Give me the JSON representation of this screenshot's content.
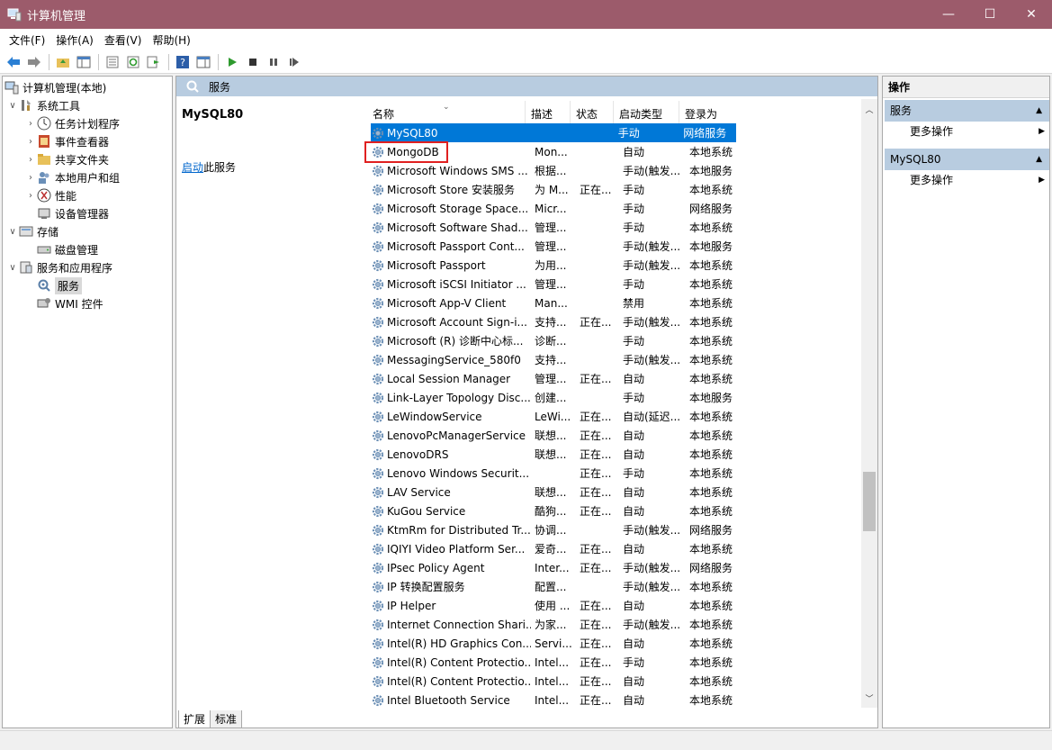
{
  "window": {
    "title": "计算机管理",
    "minimize": "—",
    "maximize": "☐",
    "close": "✕"
  },
  "menu": [
    "文件(F)",
    "操作(A)",
    "查看(V)",
    "帮助(H)"
  ],
  "tree": {
    "root": "计算机管理(本地)",
    "items": [
      {
        "label": "系统工具"
      },
      {
        "label": "任务计划程序"
      },
      {
        "label": "事件查看器"
      },
      {
        "label": "共享文件夹"
      },
      {
        "label": "本地用户和组"
      },
      {
        "label": "性能"
      },
      {
        "label": "设备管理器"
      },
      {
        "label": "存储"
      },
      {
        "label": "磁盘管理"
      },
      {
        "label": "服务和应用程序"
      },
      {
        "label": "服务"
      },
      {
        "label": "WMI 控件"
      }
    ]
  },
  "main": {
    "header": "服务",
    "selected_service": "MySQL80",
    "start_link": "启动",
    "start_text": "此服务",
    "columns": [
      "名称",
      "描述",
      "状态",
      "启动类型",
      "登录为"
    ],
    "rows": [
      {
        "name": "MySQL80",
        "desc": "",
        "state": "",
        "start": "手动",
        "logon": "网络服务"
      },
      {
        "name": "MongoDB",
        "desc": "Mon...",
        "state": "",
        "start": "自动",
        "logon": "本地系统"
      },
      {
        "name": "Microsoft Windows SMS ...",
        "desc": "根据...",
        "state": "",
        "start": "手动(触发...",
        "logon": "本地服务"
      },
      {
        "name": "Microsoft Store 安装服务",
        "desc": "为 M...",
        "state": "正在...",
        "start": "手动",
        "logon": "本地系统"
      },
      {
        "name": "Microsoft Storage Space...",
        "desc": "Micr...",
        "state": "",
        "start": "手动",
        "logon": "网络服务"
      },
      {
        "name": "Microsoft Software Shad...",
        "desc": "管理...",
        "state": "",
        "start": "手动",
        "logon": "本地系统"
      },
      {
        "name": "Microsoft Passport Cont...",
        "desc": "管理...",
        "state": "",
        "start": "手动(触发...",
        "logon": "本地服务"
      },
      {
        "name": "Microsoft Passport",
        "desc": "为用...",
        "state": "",
        "start": "手动(触发...",
        "logon": "本地系统"
      },
      {
        "name": "Microsoft iSCSI Initiator ...",
        "desc": "管理...",
        "state": "",
        "start": "手动",
        "logon": "本地系统"
      },
      {
        "name": "Microsoft App-V Client",
        "desc": "Man...",
        "state": "",
        "start": "禁用",
        "logon": "本地系统"
      },
      {
        "name": "Microsoft Account Sign-i...",
        "desc": "支持...",
        "state": "正在...",
        "start": "手动(触发...",
        "logon": "本地系统"
      },
      {
        "name": "Microsoft (R) 诊断中心标...",
        "desc": "诊断...",
        "state": "",
        "start": "手动",
        "logon": "本地系统"
      },
      {
        "name": "MessagingService_580f0",
        "desc": "支持...",
        "state": "",
        "start": "手动(触发...",
        "logon": "本地系统"
      },
      {
        "name": "Local Session Manager",
        "desc": "管理...",
        "state": "正在...",
        "start": "自动",
        "logon": "本地系统"
      },
      {
        "name": "Link-Layer Topology Disc...",
        "desc": "创建...",
        "state": "",
        "start": "手动",
        "logon": "本地服务"
      },
      {
        "name": "LeWindowService",
        "desc": "LeWi...",
        "state": "正在...",
        "start": "自动(延迟...",
        "logon": "本地系统"
      },
      {
        "name": "LenovoPcManagerService",
        "desc": "联想...",
        "state": "正在...",
        "start": "自动",
        "logon": "本地系统"
      },
      {
        "name": "LenovoDRS",
        "desc": "联想...",
        "state": "正在...",
        "start": "自动",
        "logon": "本地系统"
      },
      {
        "name": "Lenovo Windows Securit...",
        "desc": "",
        "state": "正在...",
        "start": "手动",
        "logon": "本地系统"
      },
      {
        "name": "LAV Service",
        "desc": "联想...",
        "state": "正在...",
        "start": "自动",
        "logon": "本地系统"
      },
      {
        "name": "KuGou Service",
        "desc": "酷狗...",
        "state": "正在...",
        "start": "自动",
        "logon": "本地系统"
      },
      {
        "name": "KtmRm for Distributed Tr...",
        "desc": "协调...",
        "state": "",
        "start": "手动(触发...",
        "logon": "网络服务"
      },
      {
        "name": "IQIYI Video Platform Ser...",
        "desc": "爱奇...",
        "state": "正在...",
        "start": "自动",
        "logon": "本地系统"
      },
      {
        "name": "IPsec Policy Agent",
        "desc": "Inter...",
        "state": "正在...",
        "start": "手动(触发...",
        "logon": "网络服务"
      },
      {
        "name": "IP 转换配置服务",
        "desc": "配置...",
        "state": "",
        "start": "手动(触发...",
        "logon": "本地系统"
      },
      {
        "name": "IP Helper",
        "desc": "使用 ...",
        "state": "正在...",
        "start": "自动",
        "logon": "本地系统"
      },
      {
        "name": "Internet Connection Shari...",
        "desc": "为家...",
        "state": "正在...",
        "start": "手动(触发...",
        "logon": "本地系统"
      },
      {
        "name": "Intel(R) HD Graphics Con...",
        "desc": "Servi...",
        "state": "正在...",
        "start": "自动",
        "logon": "本地系统"
      },
      {
        "name": "Intel(R) Content Protectio...",
        "desc": "Intel...",
        "state": "正在...",
        "start": "手动",
        "logon": "本地系统"
      },
      {
        "name": "Intel(R) Content Protectio...",
        "desc": "Intel...",
        "state": "正在...",
        "start": "自动",
        "logon": "本地系统"
      },
      {
        "name": "Intel Bluetooth Service",
        "desc": "Intel...",
        "state": "正在...",
        "start": "自动",
        "logon": "本地系统"
      }
    ],
    "tabs": [
      "扩展",
      "标准"
    ]
  },
  "actions": {
    "title": "操作",
    "section1": "服务",
    "more1": "更多操作",
    "section2": "MySQL80",
    "more2": "更多操作"
  },
  "colors": {
    "titlebar": "#9c5b6b",
    "selection": "#0078d7",
    "panel_header": "#b8cce0",
    "highlight_box": "#e02020"
  }
}
